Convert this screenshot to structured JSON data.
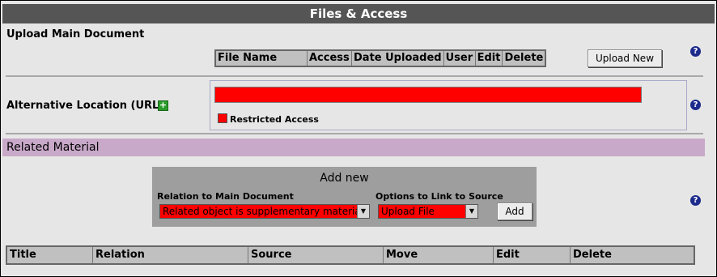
{
  "header": {
    "title": "Files & Access"
  },
  "upload": {
    "label": "Upload Main Document",
    "columns": [
      "File Name",
      "Access",
      "Date Uploaded",
      "User",
      "Edit",
      "Delete"
    ],
    "upload_button": "Upload New"
  },
  "alt_location": {
    "label": "Alternative Location (URL)",
    "plus_icon": "add-icon",
    "url_value": "",
    "restricted_label": "Restricted Access"
  },
  "related": {
    "section_label": "Related Material",
    "add_new_title": "Add new",
    "relation_label": "Relation to Main Document",
    "relation_value": "Related object is supplementary material",
    "options_label": "Options to Link to Source",
    "options_value": "Upload File",
    "add_button": "Add",
    "columns": [
      "Title",
      "Relation",
      "Source",
      "Move",
      "Edit",
      "Delete"
    ]
  },
  "help": {
    "glyph": "?"
  },
  "colors": {
    "header_bg": "#555555",
    "section_bar": "#c9a9c9",
    "required_red": "#ff0000",
    "help_blue": "#1c2a8c"
  }
}
